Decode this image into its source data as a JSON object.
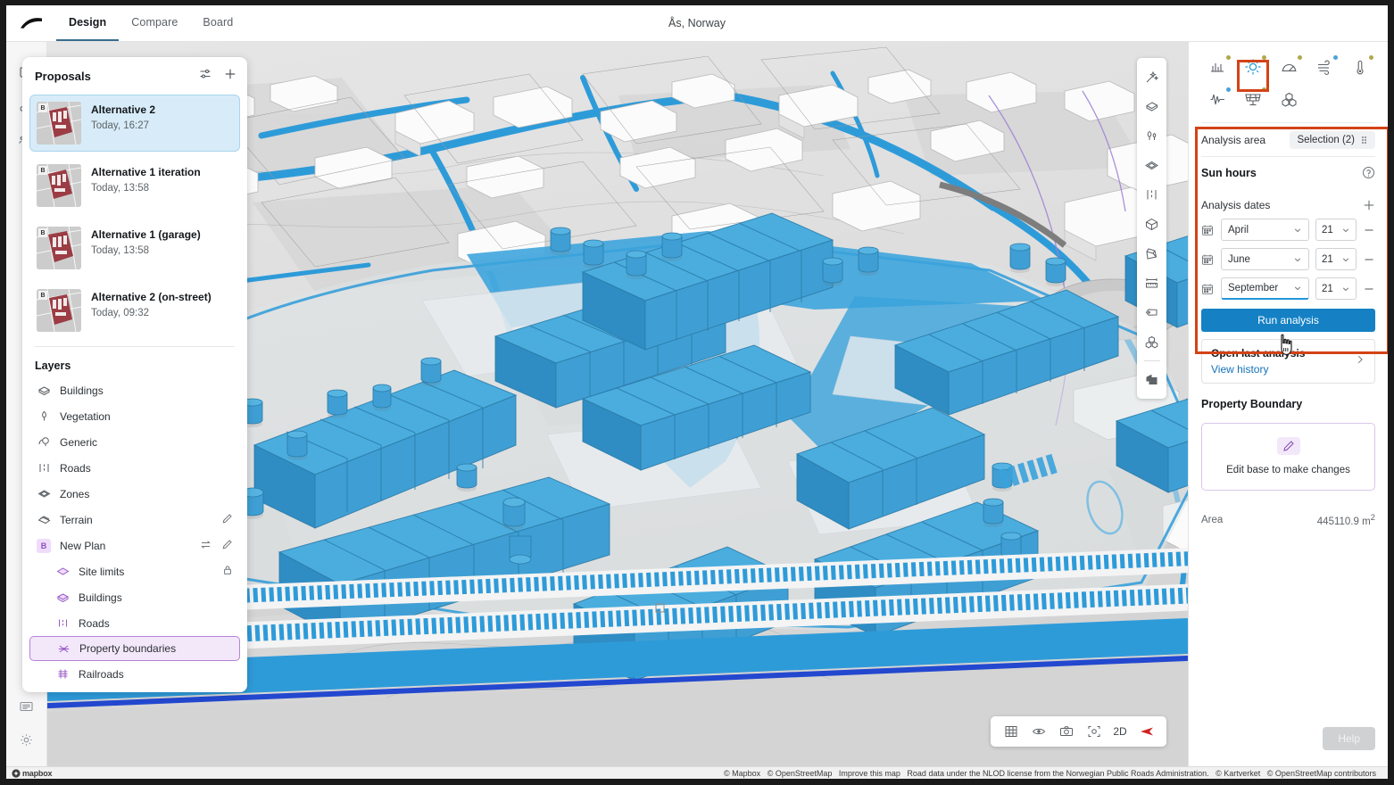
{
  "header": {
    "logo_icon": "spacemaker-logo",
    "tabs": [
      {
        "label": "Design",
        "active": true
      },
      {
        "label": "Compare",
        "active": false
      },
      {
        "label": "Board",
        "active": false
      }
    ],
    "title": "Ås, Norway"
  },
  "rail": {
    "top_icons": [
      "hamburger-menu-icon",
      "panel-layout-icon",
      "blocks-icon",
      "people-icon"
    ],
    "bottom_icons": [
      "list-view-icon",
      "gear-icon"
    ]
  },
  "proposals_panel": {
    "title": "Proposals",
    "actions": [
      "filter-sliders-icon",
      "plus-icon"
    ],
    "items": [
      {
        "name": "Alternative 2",
        "time": "Today, 16:27",
        "badge": "B",
        "selected": true
      },
      {
        "name": "Alternative 1 iteration",
        "time": "Today, 13:58",
        "badge": "B",
        "selected": false
      },
      {
        "name": "Alternative 1 (garage)",
        "time": "Today, 13:58",
        "badge": "B",
        "selected": false
      },
      {
        "name": "Alternative 2 (on-street)",
        "time": "Today, 09:32",
        "badge": "B",
        "selected": false
      }
    ],
    "layers_title": "Layers",
    "layers": [
      {
        "label": "Buildings",
        "icon": "buildings-icon",
        "child": false,
        "active": false,
        "actions": []
      },
      {
        "label": "Vegetation",
        "icon": "tree-icon",
        "child": false,
        "active": false,
        "actions": []
      },
      {
        "label": "Generic",
        "icon": "generic-icon",
        "child": false,
        "active": false,
        "actions": []
      },
      {
        "label": "Roads",
        "icon": "roads-icon",
        "child": false,
        "active": false,
        "actions": []
      },
      {
        "label": "Zones",
        "icon": "zones-icon",
        "child": false,
        "active": false,
        "actions": []
      },
      {
        "label": "Terrain",
        "icon": "terrain-icon",
        "child": false,
        "active": false,
        "actions": [
          "pencil-icon"
        ]
      },
      {
        "label": "New Plan",
        "icon": "plan-badge-b",
        "child": false,
        "active": false,
        "actions": [
          "swap-icon",
          "pencil-icon"
        ]
      },
      {
        "label": "Site limits",
        "icon": "site-limits-icon",
        "child": true,
        "active": false,
        "actions": [
          "lock-icon"
        ]
      },
      {
        "label": "Buildings",
        "icon": "buildings-icon",
        "child": true,
        "active": false,
        "actions": []
      },
      {
        "label": "Roads",
        "icon": "roads-icon",
        "child": true,
        "active": false,
        "actions": []
      },
      {
        "label": "Property boundaries",
        "icon": "property-boundaries-icon",
        "child": true,
        "active": true,
        "actions": []
      },
      {
        "label": "Railroads",
        "icon": "railroads-icon",
        "child": true,
        "active": false,
        "actions": []
      }
    ]
  },
  "map_toolbar": {
    "tools": [
      "magic-wand-icon",
      "building-icon",
      "trees-icon",
      "zone-icon",
      "road-icon",
      "cube-icon",
      "extrude-icon",
      "measure-icon",
      "tag-icon",
      "blocks-icon",
      "divider",
      "property-pattern-icon"
    ]
  },
  "analysis_panel": {
    "analysis_icons": [
      {
        "name": "bar-chart-icon",
        "selected": false,
        "dot": "#b0a84a"
      },
      {
        "name": "sun-hours-icon",
        "selected": true,
        "dot": "#b0a84a"
      },
      {
        "name": "daylight-icon",
        "selected": false,
        "dot": "#b0a84a"
      },
      {
        "name": "wind-icon",
        "selected": false,
        "dot": "#4aa3d8"
      },
      {
        "name": "thermometer-icon",
        "selected": false,
        "dot": "#b0a84a"
      },
      {
        "name": "noise-icon",
        "selected": false,
        "dot": "#4aa3d8"
      },
      {
        "name": "solar-panel-icon",
        "selected": false,
        "dot": "#b0a84a"
      },
      {
        "name": "volume-blocks-icon",
        "selected": false,
        "dot": ""
      }
    ],
    "analysis_area_label": "Analysis area",
    "analysis_area_value": "Selection (2)",
    "section_title": "Sun hours",
    "help_icon": "question-circle-icon",
    "dates_label": "Analysis dates",
    "add_date_icon": "plus-icon",
    "dates": [
      {
        "month": "April",
        "day": "21",
        "focused": false
      },
      {
        "month": "June",
        "day": "21",
        "focused": false
      },
      {
        "month": "September",
        "day": "21",
        "focused": true
      }
    ],
    "run_button": "Run analysis",
    "history": {
      "line1": "Open last analysis",
      "line2": "View history"
    },
    "property_boundary": {
      "title": "Property Boundary",
      "edit_icon": "pencil-icon",
      "edit_text": "Edit base to make changes",
      "area_label": "Area",
      "area_value": "445110.9 m",
      "area_unit": "2"
    },
    "help_button": "Help",
    "highlight_color": "#d34317",
    "accent_color": "#1581c4"
  },
  "bottom_toolbar": {
    "items": [
      {
        "name": "grid-icon",
        "label": ""
      },
      {
        "name": "eye-icon",
        "label": ""
      },
      {
        "name": "camera-icon",
        "label": ""
      },
      {
        "name": "focus-icon",
        "label": ""
      },
      {
        "name": "view-mode-toggle",
        "label": "2D"
      },
      {
        "name": "compass-icon",
        "label": ""
      }
    ]
  },
  "attribution": {
    "mapbox_logo": "mapbox",
    "items": [
      "© Mapbox",
      "© OpenStreetMap",
      "Improve this map",
      "Road data under the NLOD license from the Norwegian Public Roads Administration.",
      "© Kartverket",
      "© OpenStreetMap contributors"
    ]
  },
  "cursor": {
    "icon": "pointing-hand-cursor"
  }
}
